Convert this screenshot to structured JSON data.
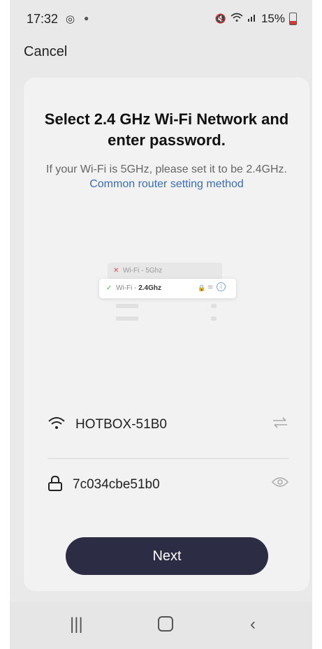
{
  "status": {
    "time": "17:32",
    "battery": "15%"
  },
  "header": {
    "cancel_label": "Cancel"
  },
  "card": {
    "title": "Select 2.4 GHz Wi-Fi Network and enter password.",
    "subtitle_prefix": "If your Wi-Fi is 5GHz, please set it to be 2.4GHz.",
    "link_text": "Common router setting method"
  },
  "illustration": {
    "row_5g": "Wi-Fi - 5Ghz",
    "row_24_prefix": "Wi-Fi - ",
    "row_24_bold": "2.4Ghz"
  },
  "network": {
    "ssid": "HOTBOX-51B0",
    "password": "7c034cbe51b0"
  },
  "actions": {
    "next_label": "Next"
  },
  "colors": {
    "accent": "#2c2c45",
    "link": "#3a6db5"
  }
}
